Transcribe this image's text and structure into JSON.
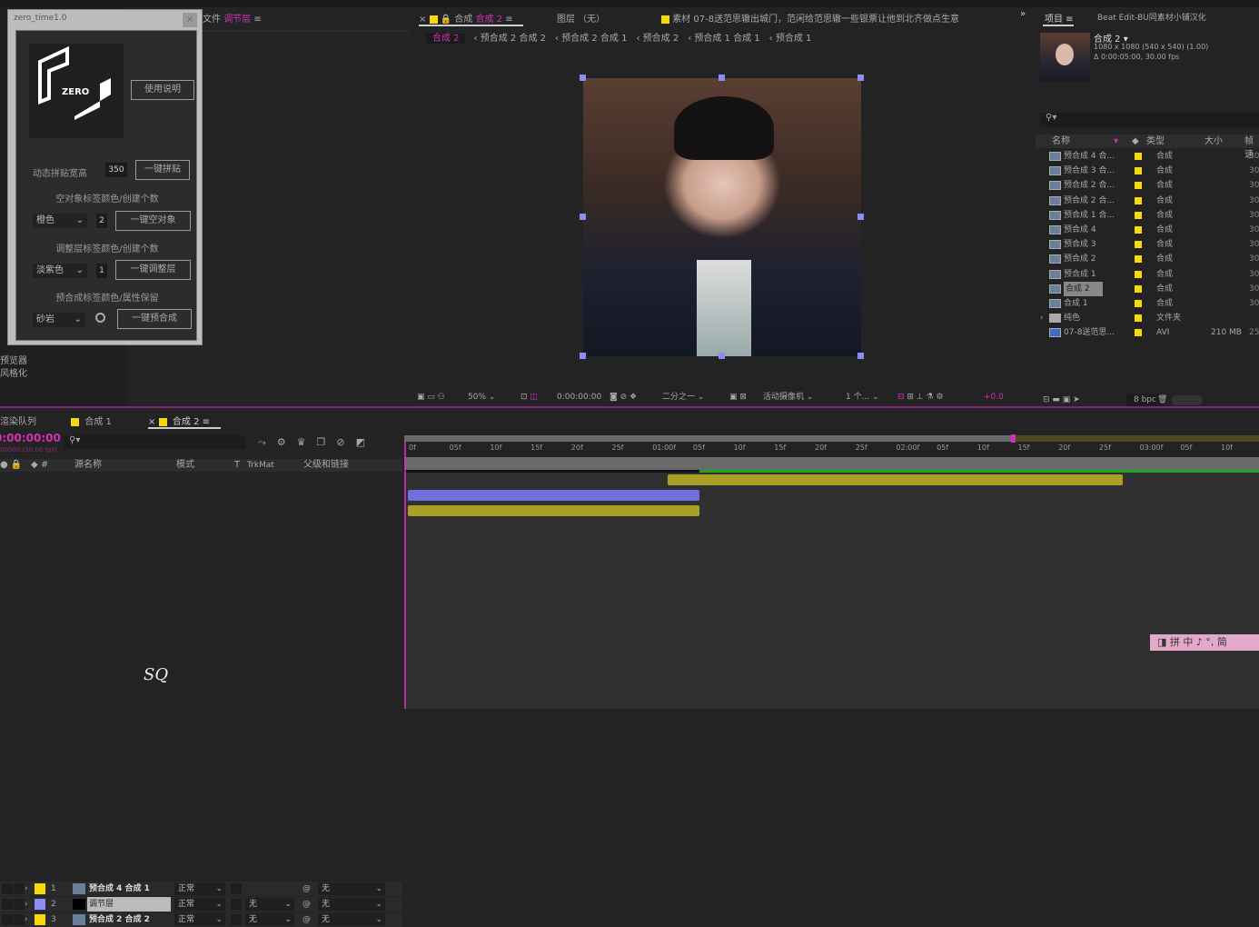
{
  "dialog": {
    "title": "zero_time1.0",
    "close": "×",
    "logo_text": "ZERO",
    "help_btn": "使用说明",
    "paste_label": "动态拼贴宽高",
    "paste_value": "350",
    "paste_btn": "一键拼贴",
    "null_label": "空对象标签颜色/创建个数",
    "null_color": "橙色",
    "null_count": "2",
    "null_btn": "一键空对象",
    "adj_label": "调整层标签颜色/创建个数",
    "adj_color": "淡紫色",
    "adj_count": "1",
    "adj_btn": "一键调整层",
    "precomp_label": "预合成标签颜色/属性保留",
    "precomp_color": "砂岩",
    "precomp_btn": "一键预合成"
  },
  "effects_panel": {
    "header_prefix": "文件",
    "header_layer": "调节层",
    "items": [
      "预览器",
      "风格化"
    ]
  },
  "viewer": {
    "tabs": [
      {
        "label": "合成",
        "active": "合成 2"
      },
      {
        "label": "图层 （无）"
      },
      {
        "label": "素材 07-8送范思辙出城门，范闲给范思辙一些银票让他到北齐做点生意"
      }
    ],
    "breadcrumb": [
      "合成 2",
      "预合成 2 合成 2",
      "预合成 2 合成 1",
      "预合成 2",
      "预合成 1 合成 1",
      "预合成 1"
    ],
    "toolbar": {
      "zoom": "50%",
      "timecode": "0:00:00:00",
      "resolution": "二分之一",
      "camera": "活动摄像机",
      "views": "1 个...",
      "exposure": "+0.0"
    }
  },
  "project": {
    "tabs": [
      "项目",
      "Beat Edit-BU同素材小铺汉化"
    ],
    "comp_name": "合成 2",
    "comp_size": "1080 x 1080  (540 x 540) (1.00)",
    "comp_duration": "Δ 0:00:05:00, 30.00 fps",
    "columns": [
      "名称",
      "类型",
      "大小",
      "帧速"
    ],
    "items": [
      {
        "name": "预合成 4 合...",
        "type": "合成",
        "size": "",
        "fps": "30"
      },
      {
        "name": "预合成 3 合...",
        "type": "合成",
        "size": "",
        "fps": "30"
      },
      {
        "name": "预合成 2 合...",
        "type": "合成",
        "size": "",
        "fps": "30"
      },
      {
        "name": "预合成 2 合...",
        "type": "合成",
        "size": "",
        "fps": "30"
      },
      {
        "name": "预合成 1 合...",
        "type": "合成",
        "size": "",
        "fps": "30"
      },
      {
        "name": "预合成 4",
        "type": "合成",
        "size": "",
        "fps": "30"
      },
      {
        "name": "预合成 3",
        "type": "合成",
        "size": "",
        "fps": "30"
      },
      {
        "name": "预合成 2",
        "type": "合成",
        "size": "",
        "fps": "30"
      },
      {
        "name": "预合成 1",
        "type": "合成",
        "size": "",
        "fps": "30"
      },
      {
        "name": "合成 2",
        "type": "合成",
        "size": "",
        "fps": "30",
        "selected": true
      },
      {
        "name": "合成 1",
        "type": "合成",
        "size": "",
        "fps": "30"
      },
      {
        "name": "纯色",
        "type": "文件夹",
        "size": "",
        "fps": ""
      },
      {
        "name": "07-8送范思...",
        "type": "AVI",
        "size": "210 MB",
        "fps": "25"
      }
    ],
    "bpc": "8 bpc"
  },
  "timeline": {
    "tabs": [
      "渲染队列",
      "合成 1",
      "合成 2"
    ],
    "timecode": "0:00:00:00",
    "sub_timecode": "00000 (30.00 fps)",
    "columns": [
      "源名称",
      "模式",
      "T",
      "TrkMat",
      "父级和链接"
    ],
    "layers": [
      {
        "num": "1",
        "name": "预合成 4 合成 1",
        "color": "#f5d90a",
        "mode": "正常",
        "trkmat": "",
        "parent": "无"
      },
      {
        "num": "2",
        "name": "调节层",
        "color": "#8c8cf5",
        "mode": "正常",
        "trkmat": "无",
        "parent": "无"
      },
      {
        "num": "3",
        "name": "预合成 2 合成 2",
        "color": "#f5d90a",
        "mode": "正常",
        "trkmat": "无",
        "parent": "无"
      }
    ],
    "ruler": [
      "0f",
      "05f",
      "10f",
      "15f",
      "20f",
      "25f",
      "01:00f",
      "05f",
      "10f",
      "15f",
      "20f",
      "25f",
      "02:00f",
      "05f",
      "10f",
      "15f",
      "20f",
      "25f",
      "03:00f",
      "05f",
      "10f"
    ]
  },
  "ime": {
    "text": "拼 中 ♪ °, 简"
  },
  "watermark": "SQ",
  "colors": {
    "accent": "#d52fb8",
    "label_yellow": "#f5d90a",
    "label_lavender": "#8c8cf5"
  }
}
